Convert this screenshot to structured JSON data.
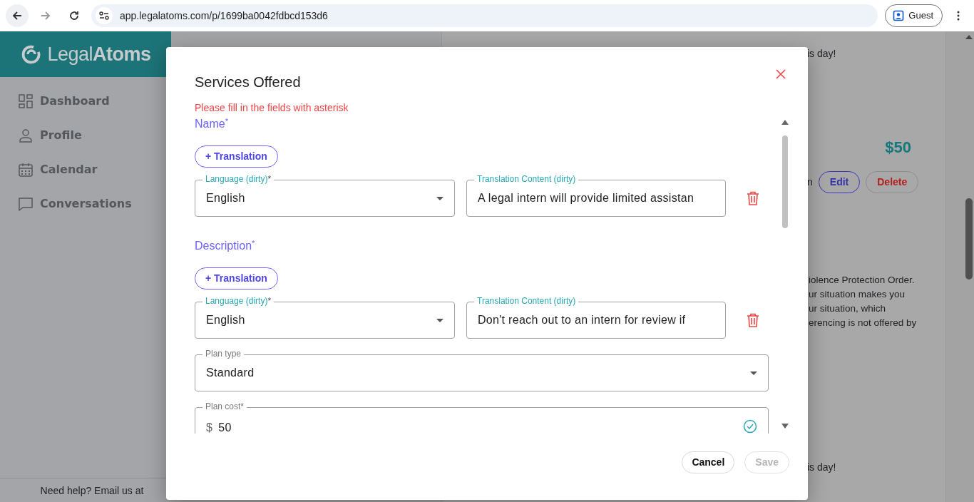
{
  "browser": {
    "url": "app.legalatoms.com/p/1699ba0042fdbcd153d6",
    "profile": "Guest"
  },
  "sidebar": {
    "logo": "Legal**Atoms**",
    "items": [
      {
        "kind": "dashboard",
        "label": "Dashboard"
      },
      {
        "kind": "profile",
        "label": "Profile"
      },
      {
        "kind": "calendar",
        "label": "Calendar"
      },
      {
        "kind": "conversations",
        "label": "Conversations"
      }
    ],
    "help": "Need help? Email us at"
  },
  "background": {
    "greeting": "is day!",
    "price": "$50",
    "action_prefix": "n",
    "actions": [
      {
        "kind": "edit",
        "label": "Edit"
      },
      {
        "kind": "delete",
        "label": "Delete"
      }
    ],
    "description_lines": [
      "iolence Protection Order.",
      "ur situation makes you",
      "ur situation, which",
      "erencing is not offered by"
    ],
    "greeting_2": "is day!"
  },
  "modal": {
    "title": "Services Offered",
    "warning": "Please fill in the fields with asterisk",
    "sections": [
      {
        "label": "Name$^{*}$",
        "add_button": "+ Translation",
        "translations": [
          {
            "language_label": "Language (dirty)",
            "language_mark": "*",
            "language": "English",
            "content_label": "Translation Content (dirty)",
            "content": "A legal intern will provide limited assistan"
          }
        ]
      },
      {
        "label": "Description$^{*}$",
        "add_button": "+ Translation",
        "translations": [
          {
            "language_label": "Language (dirty)",
            "language_mark": "*",
            "language": "English",
            "content_label": "Translation Content (dirty)",
            "content": "Don't reach out to an intern for review if"
          }
        ]
      }
    ],
    "plan_type": {
      "label": "Plan type",
      "value": "Standard"
    },
    "plan_cost": {
      "label": "Plan cost*",
      "prefix": "$",
      "value": "50",
      "valid": true
    },
    "buttons": [
      {
        "kind": "cancel",
        "label": "Cancel",
        "disabled": false
      },
      {
        "kind": "save",
        "label": "Save",
        "disabled": true
      }
    ]
  }
}
